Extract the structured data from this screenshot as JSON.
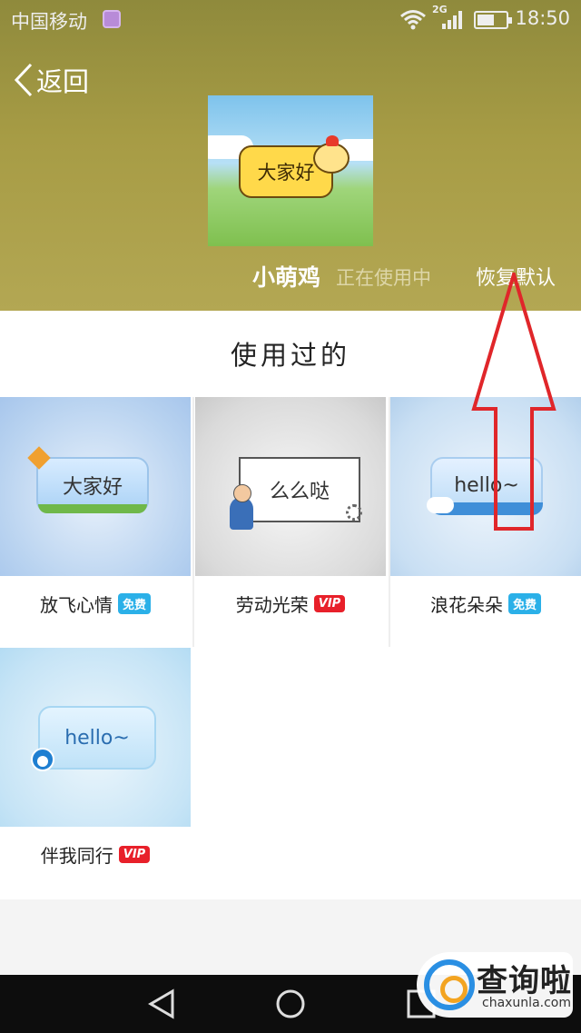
{
  "status_bar": {
    "carrier": "中国移动",
    "network": "2G",
    "time": "18:50",
    "battery_level": 0.6
  },
  "header": {
    "back_label": "返回",
    "current_theme": {
      "preview_text": "大家好",
      "name": "小萌鸡",
      "status": "正在使用中"
    },
    "restore_label": "恢复默认"
  },
  "section_title": "使用过的",
  "items": [
    {
      "name": "放飞心情",
      "tag": "免费",
      "tag_type": "free",
      "bubble_text": "大家好"
    },
    {
      "name": "劳动光荣",
      "tag": "VIP",
      "tag_type": "vip",
      "bubble_text": "么么哒"
    },
    {
      "name": "浪花朵朵",
      "tag": "免费",
      "tag_type": "free",
      "bubble_text": "hello~"
    },
    {
      "name": "伴我同行",
      "tag": "VIP",
      "tag_type": "vip",
      "bubble_text": "hello~"
    }
  ],
  "watermark": {
    "title": "查询啦",
    "site": "chaxunla.com"
  },
  "colors": {
    "header_bg": "#a79c45",
    "free_tag": "#2bb0e8",
    "vip_tag": "#e8202a",
    "annotation_arrow": "#e0262a"
  }
}
